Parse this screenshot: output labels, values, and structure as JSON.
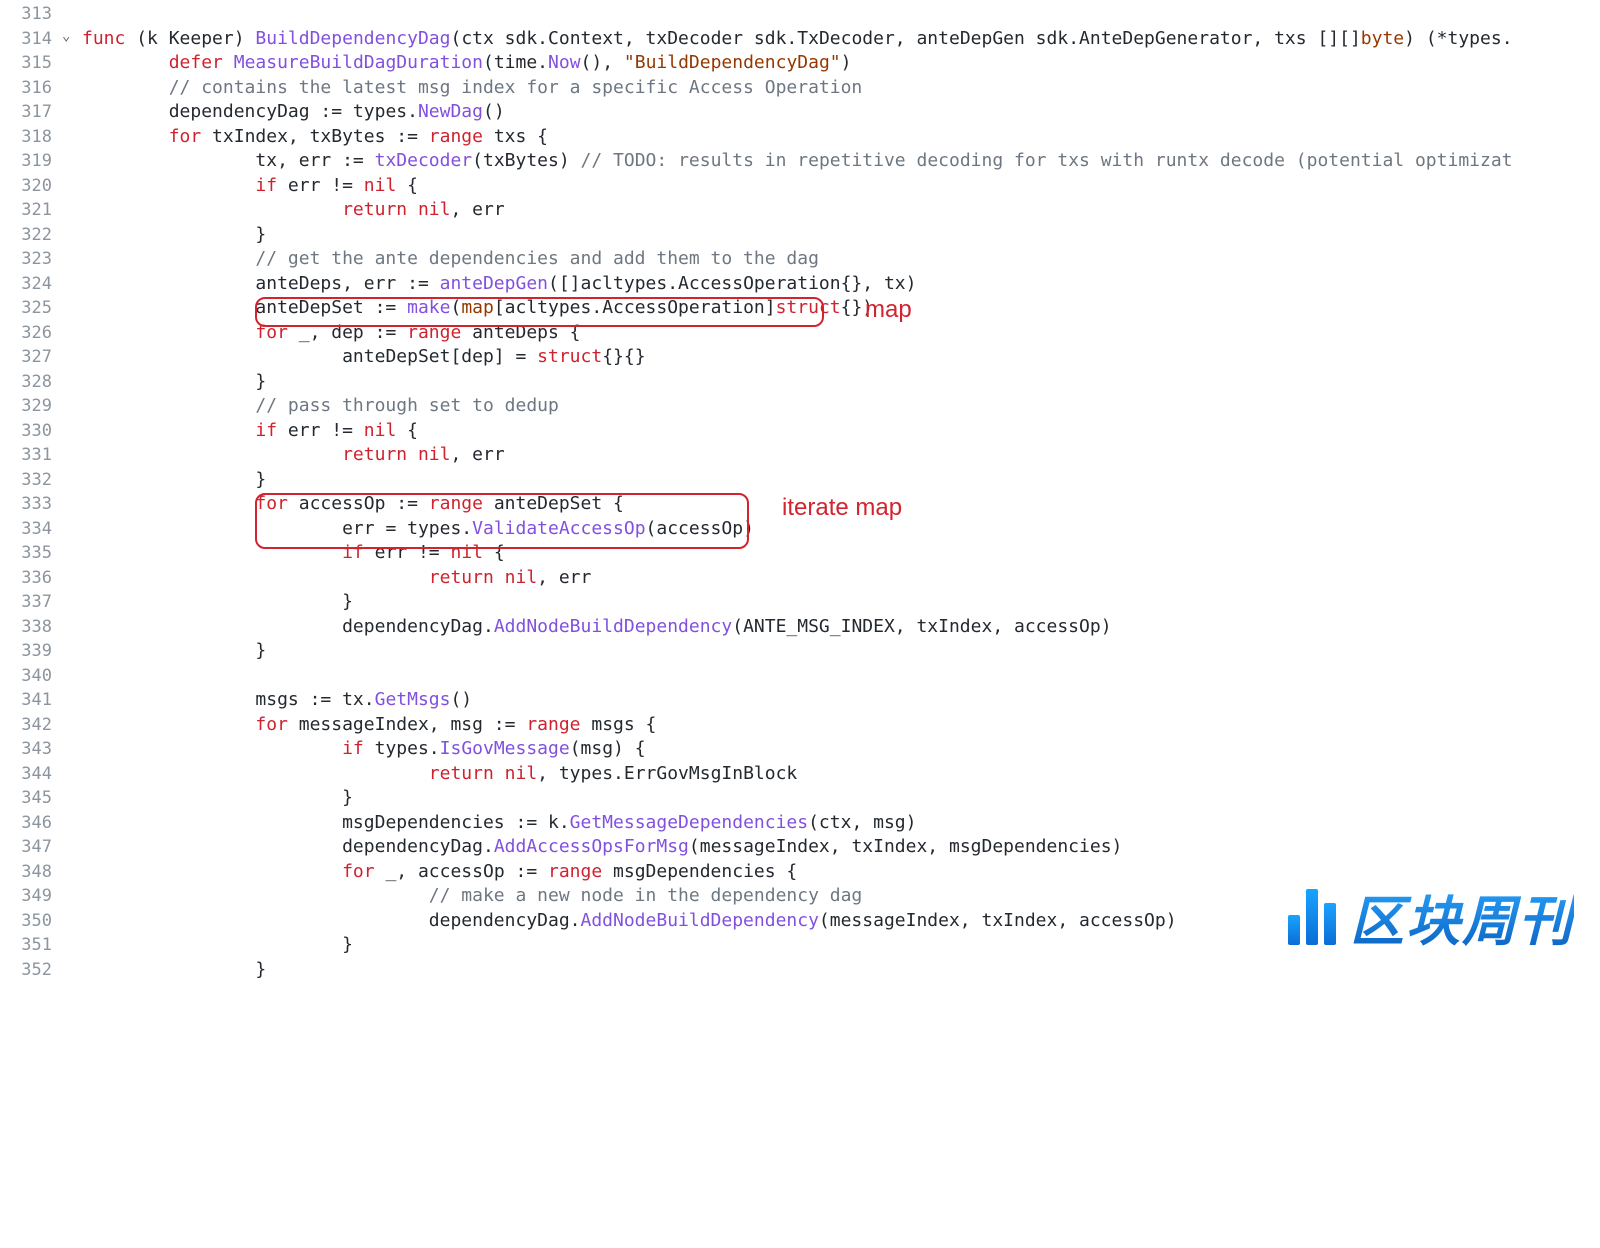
{
  "gutter": {
    "start": 313,
    "end": 352
  },
  "annotations": {
    "a1": "map",
    "a2": "iterate map"
  },
  "watermark": "区块周刊",
  "code": {
    "l313": {},
    "l314": {
      "kw1": "func",
      "id1": " (k Keeper) ",
      "fn": "BuildDependencyDag",
      "sig": "(ctx sdk.Context, txDecoder sdk.TxDecoder, anteDepGen sdk.AnteDepGenerator, txs [][]",
      "ty1": "byte",
      "sig2": ") (*types."
    },
    "l315": {
      "kw": "defer",
      "sp": " ",
      "fn": "MeasureBuildDagDuration",
      "args": "(time.",
      "fn2": "Now",
      "args2": "(), ",
      "str": "\"BuildDependencyDag\"",
      "end": ")"
    },
    "l316": {
      "cm": "// contains the latest msg index for a specific Access Operation"
    },
    "l317": {
      "id": "dependencyDag := types.",
      "fn": "NewDag",
      "end": "()"
    },
    "l318": {
      "kw": "for",
      "id": " txIndex, txBytes := ",
      "kw2": "range",
      "id2": " txs {"
    },
    "l319": {
      "id": "tx, err := ",
      "fn": "txDecoder",
      "args": "(txBytes) ",
      "cm": "// TODO: results in repetitive decoding for txs with runtx decode (potential optimizat"
    },
    "l320": {
      "kw": "if",
      "id": " err != ",
      "kw2": "nil",
      "id2": " {"
    },
    "l321": {
      "kw": "return",
      "id": " ",
      "kw2": "nil",
      "id2": ", err"
    },
    "l322": {
      "id": "}"
    },
    "l323": {
      "cm": "// get the ante dependencies and add them to the dag"
    },
    "l324": {
      "id": "anteDeps, err := ",
      "fn": "anteDepGen",
      "args": "([]acltypes.AccessOperation{}, tx)"
    },
    "l325": {
      "id": "anteDepSet := ",
      "fn": "make",
      "args": "(",
      "ty": "map",
      "args2": "[acltypes.AccessOperation]",
      "kw": "struct",
      "args3": "{})"
    },
    "l326": {
      "kw": "for",
      "id": " _, dep := ",
      "kw2": "range",
      "id2": " anteDeps {"
    },
    "l327": {
      "id": "anteDepSet[dep] = ",
      "kw": "struct",
      "id2": "{}{}"
    },
    "l328": {
      "id": "}"
    },
    "l329": {
      "cm": "// pass through set to dedup"
    },
    "l330": {
      "kw": "if",
      "id": " err != ",
      "kw2": "nil",
      "id2": " {"
    },
    "l331": {
      "kw": "return",
      "id": " ",
      "kw2": "nil",
      "id2": ", err"
    },
    "l332": {
      "id": "}"
    },
    "l333": {
      "kw": "for",
      "id": " accessOp := ",
      "kw2": "range",
      "id2": " anteDepSet {"
    },
    "l334": {
      "id": "err = types.",
      "fn": "ValidateAccessOp",
      "args": "(accessOp)"
    },
    "l335": {
      "kw": "if",
      "id": " err != ",
      "kw2": "nil",
      "id2": " {"
    },
    "l336": {
      "kw": "return",
      "id": " ",
      "kw2": "nil",
      "id2": ", err"
    },
    "l337": {
      "id": "}"
    },
    "l338": {
      "id": "dependencyDag.",
      "fn": "AddNodeBuildDependency",
      "args": "(ANTE_MSG_INDEX, txIndex, accessOp)"
    },
    "l339": {
      "id": "}"
    },
    "l340": {},
    "l341": {
      "id": "msgs := tx.",
      "fn": "GetMsgs",
      "args": "()"
    },
    "l342": {
      "kw": "for",
      "id": " messageIndex, msg := ",
      "kw2": "range",
      "id2": " msgs {"
    },
    "l343": {
      "kw": "if",
      "id": " types.",
      "fn": "IsGovMessage",
      "args": "(msg) {"
    },
    "l344": {
      "kw": "return",
      "id": " ",
      "kw2": "nil",
      "id2": ", types.ErrGovMsgInBlock"
    },
    "l345": {
      "id": "}"
    },
    "l346": {
      "id": "msgDependencies := k.",
      "fn": "GetMessageDependencies",
      "args": "(ctx, msg)"
    },
    "l347": {
      "id": "dependencyDag.",
      "fn": "AddAccessOpsForMsg",
      "args": "(messageIndex, txIndex, msgDependencies)"
    },
    "l348": {
      "kw": "for",
      "id": " _, accessOp := ",
      "kw2": "range",
      "id2": " msgDependencies {"
    },
    "l349": {
      "cm": "// make a new node in the dependency dag"
    },
    "l350": {
      "id": "dependencyDag.",
      "fn": "AddNodeBuildDependency",
      "args": "(messageIndex, txIndex, accessOp)"
    },
    "l351": {
      "id": "}"
    },
    "l352": {
      "id": "}"
    }
  }
}
